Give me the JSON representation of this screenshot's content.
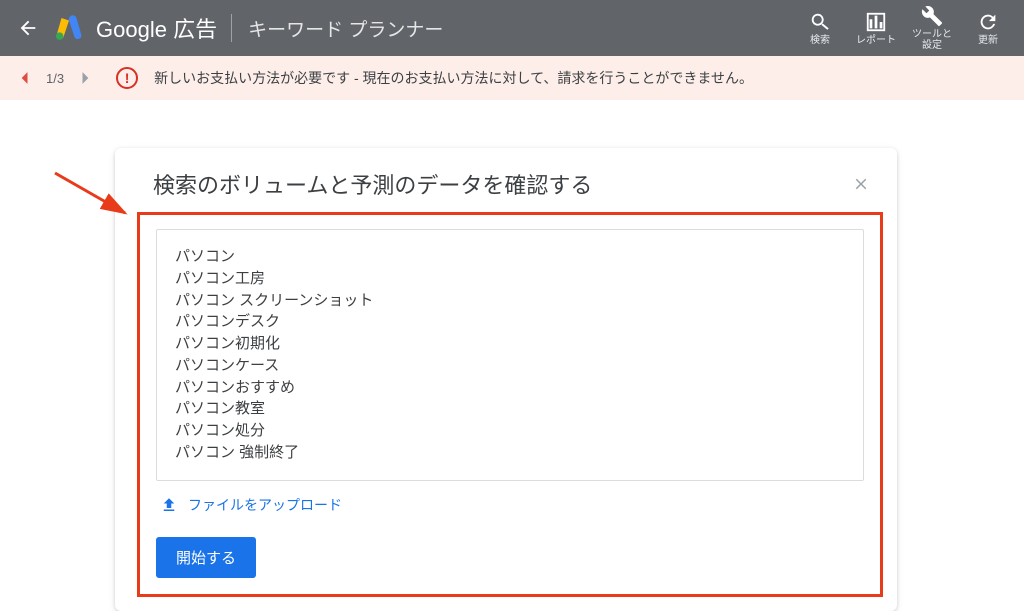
{
  "header": {
    "brand_google": "Google",
    "brand_ads": "広告",
    "tool_title": "キーワード プランナー",
    "icons": {
      "search": "検索",
      "reports": "レポート",
      "tools": "ツールと\n設定",
      "refresh": "更新"
    }
  },
  "alert": {
    "pager": "1/3",
    "message": "新しいお支払い方法が必要です - 現在のお支払い方法に対して、請求を行うことができません。"
  },
  "card": {
    "title": "検索のボリュームと予測のデータを確認する",
    "keywords": [
      "パソコン",
      "パソコン工房",
      "パソコン スクリーンショット",
      "パソコンデスク",
      "パソコン初期化",
      "パソコンケース",
      "パソコンおすすめ",
      "パソコン教室",
      "パソコン処分",
      "パソコン 強制終了"
    ],
    "upload_label": "ファイルをアップロード",
    "start_label": "開始する"
  }
}
